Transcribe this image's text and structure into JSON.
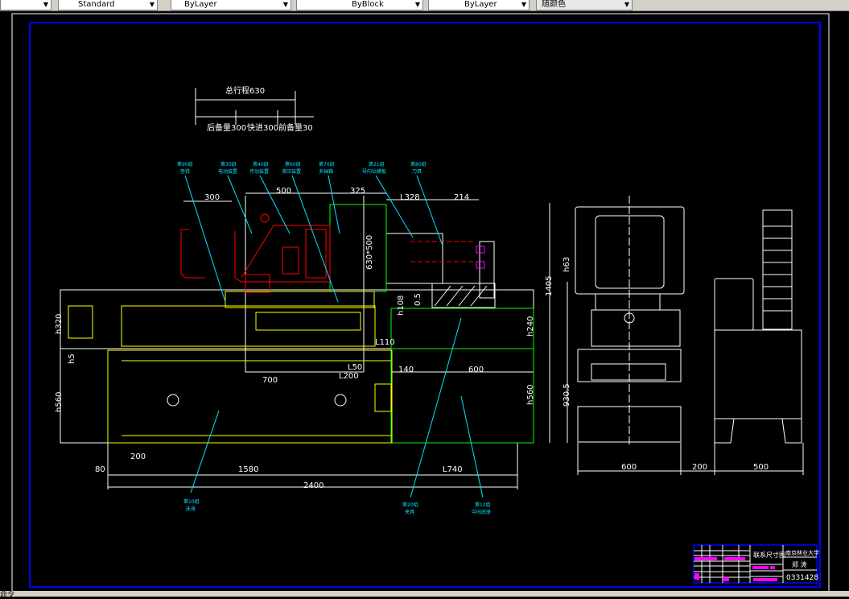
{
  "toolbar": {
    "textstyle": "Standard",
    "layer": "ByLayer",
    "linetype": "ByBlock",
    "lineweight": "ByLayer",
    "color": "随颜色"
  },
  "stroke_diagram": {
    "total": "总行程630",
    "rear": "后备量300",
    "fast": "快进300",
    "front": "前备量30"
  },
  "dims": {
    "d300": "300",
    "d500": "500",
    "d325": "325",
    "l328": "L328",
    "d214": "214",
    "d630x500": "630*500",
    "h320": "h320",
    "h5": "h5",
    "h560l": "h560",
    "h108": "h108",
    "d05": "0.5",
    "h240": "h240",
    "h560r": "h560",
    "l110": "L110",
    "l50": "L50",
    "l200": "L200",
    "d700": "700",
    "d140": "140",
    "d600": "600",
    "d200": "200",
    "d80": "80",
    "d1580": "1580",
    "l740": "L740",
    "d2400": "2400",
    "h63": "h63",
    "d1405": "1405",
    "d930": "930.5",
    "s600": "600",
    "s200": "200",
    "s500": "500"
  },
  "labels": [
    {
      "group": "第90组",
      "name": "垫铁"
    },
    {
      "group": "第30组",
      "name": "电动装置"
    },
    {
      "group": "第40组",
      "name": "传动装置"
    },
    {
      "group": "第60组",
      "name": "液压装置"
    },
    {
      "group": "第70组",
      "name": "多轴箱"
    },
    {
      "group": "第21组",
      "name": "导向钻模板"
    },
    {
      "group": "第80组",
      "name": "刀具"
    },
    {
      "group": "第10组",
      "name": "床身"
    },
    {
      "group": "第20组",
      "name": "夹具"
    },
    {
      "group": "第12组",
      "name": "中间底座"
    }
  ],
  "title_block": {
    "drawing_name": "联系尺寸图",
    "school": "南京林业大学",
    "author": "郑 涛",
    "number": "0331428"
  },
  "command_line": "命令",
  "colors": {
    "background": "#000000",
    "dimension": "#ffffff",
    "leader": "#00e5ff",
    "bed": "#ffff00",
    "power_head": "#ff0000",
    "spindle_box": "#00ff00",
    "frame": "#0000ff",
    "title_accent": "#ff00ff"
  }
}
